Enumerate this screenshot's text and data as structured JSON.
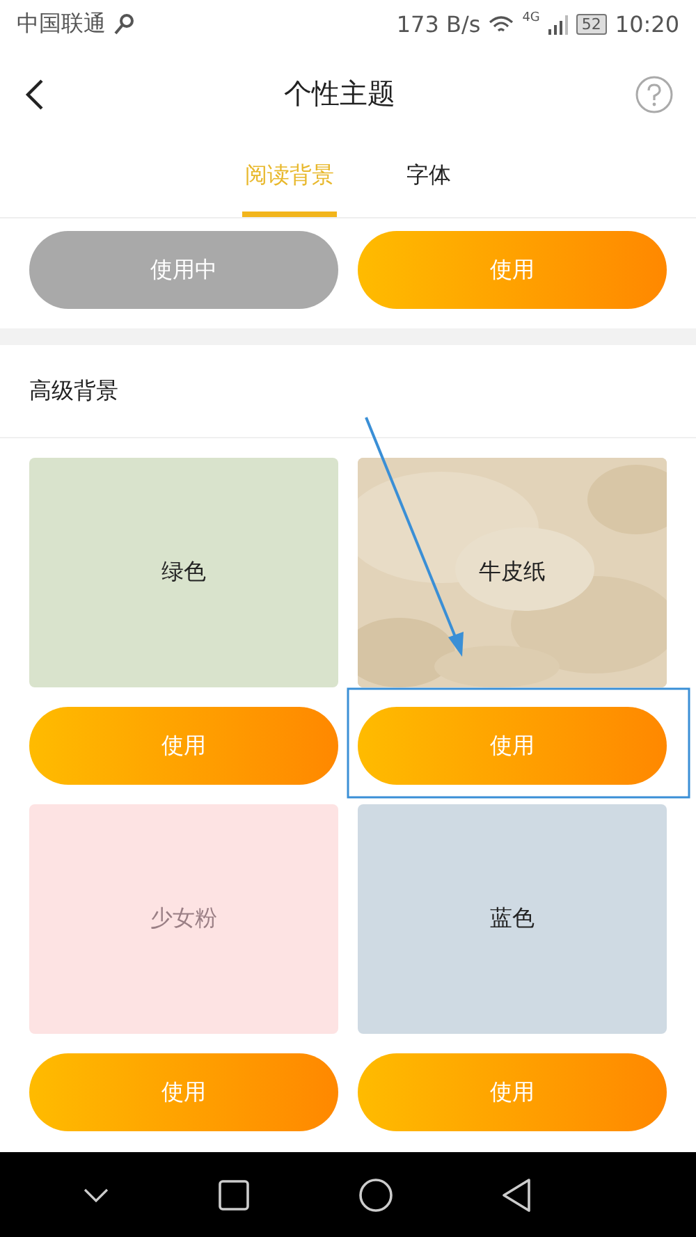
{
  "status_bar": {
    "carrier": "中国联通",
    "speed": "173 B/s",
    "network": "4G",
    "battery": "52",
    "time": "10:20"
  },
  "header": {
    "title": "个性主题"
  },
  "tabs": [
    {
      "label": "阅读背景",
      "selected": true
    },
    {
      "label": "字体",
      "selected": false
    }
  ],
  "top_buttons": [
    {
      "label": "使用中",
      "in_use": true
    },
    {
      "label": "使用",
      "in_use": false
    }
  ],
  "section": {
    "title": "高级背景"
  },
  "backgrounds": [
    {
      "name": "绿色",
      "kind": "plain",
      "color": "#d9e3cc",
      "faded": false,
      "button": {
        "label": "使用",
        "in_use": false
      }
    },
    {
      "name": "牛皮纸",
      "kind": "picture",
      "color": "#e3d5bd",
      "faded": false,
      "button": {
        "label": "使用",
        "in_use": false
      }
    },
    {
      "name": "少女粉",
      "kind": "plain",
      "color": "#fde3e3",
      "faded": true,
      "button": {
        "label": "使用",
        "in_use": false
      }
    },
    {
      "name": "蓝色",
      "kind": "plain",
      "color": "#cfdae3",
      "faded": false,
      "button": {
        "label": "使用",
        "in_use": false
      }
    }
  ]
}
